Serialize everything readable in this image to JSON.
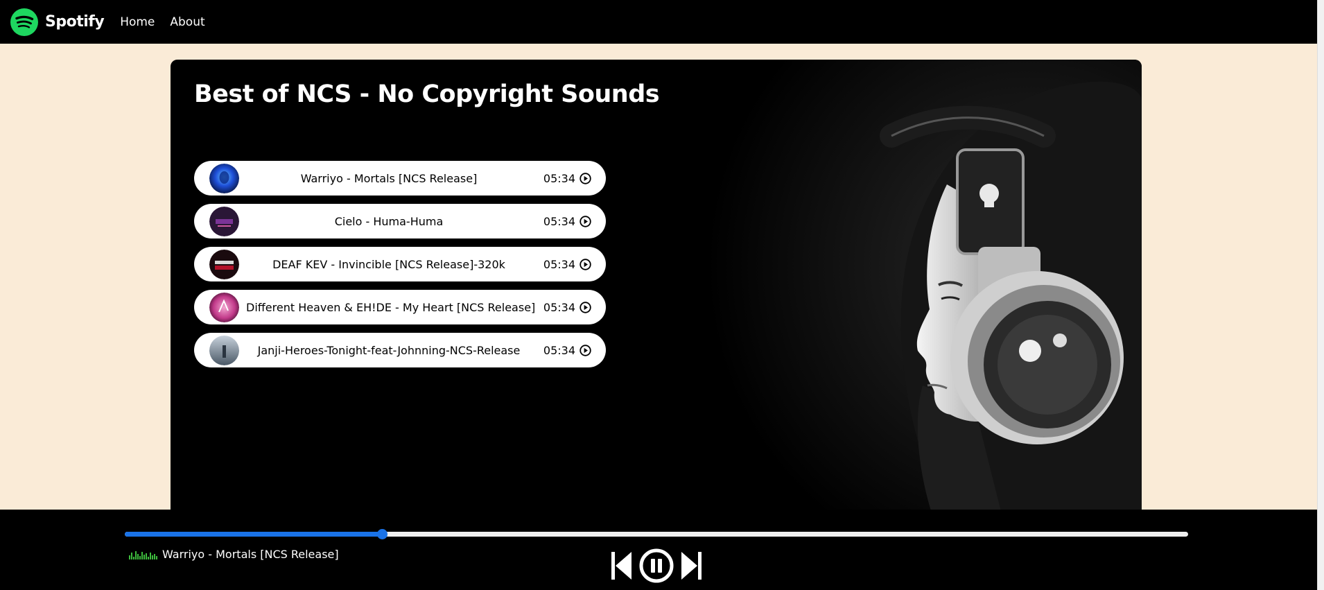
{
  "nav": {
    "brand": "Spotify",
    "links": [
      "Home",
      "About"
    ]
  },
  "playlist": {
    "title": "Best of NCS - No Copyright Sounds",
    "songs": [
      {
        "name": "Warriyo - Mortals [NCS Release]",
        "duration": "05:34",
        "cover_color": "#1e4fd8"
      },
      {
        "name": "Cielo - Huma-Huma",
        "duration": "05:34",
        "cover_color": "#5a2a7a"
      },
      {
        "name": "DEAF KEV - Invincible [NCS Release]-320k",
        "duration": "05:34",
        "cover_color": "#b3122a"
      },
      {
        "name": "Different Heaven & EH!DE - My Heart [NCS Release]",
        "duration": "05:34",
        "cover_color": "#c23a8a"
      },
      {
        "name": "Janji-Heroes-Tonight-feat-Johnning-NCS-Release",
        "duration": "05:34",
        "cover_color": "#9aa6b2"
      }
    ]
  },
  "player": {
    "progress_percent": 24.2,
    "now_playing": "Warriyo - Mortals [NCS Release]",
    "accent": "#1a73e8",
    "controls": [
      "previous-icon",
      "pause-icon",
      "next-icon"
    ]
  },
  "colors": {
    "page_bg": "#faebd7",
    "brand_green": "#1ed760"
  }
}
